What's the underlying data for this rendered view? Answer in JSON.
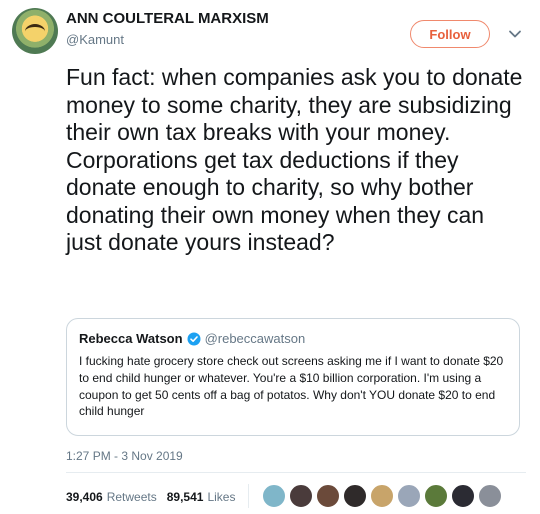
{
  "author": {
    "name": "ANN COULTERAL MARXISM",
    "handle": "@Kamunt"
  },
  "follow_label": "Follow",
  "tweet_text": "Fun fact: when companies ask you to donate money to some charity, they are subsidizing their own tax breaks with your money. Corporations get tax deductions if they donate enough to charity, so why bother donating their own money when they can just donate yours instead?",
  "quoted": {
    "name": "Rebecca Watson",
    "handle": "@rebeccawatson",
    "text": "I fucking hate grocery store check out screens asking me if I want to donate $20 to end child hunger or whatever. You're a $10 billion corporation. I'm using a coupon to get 50 cents off a bag of potatos. Why don't YOU donate $20 to end child hunger"
  },
  "timestamp": "1:27 PM - 3 Nov 2019",
  "stats": {
    "retweets_count": "39,406",
    "retweets_label": "Retweets",
    "likes_count": "89,541",
    "likes_label": "Likes"
  },
  "colors": {
    "follow_accent": "#e8603c",
    "verified_blue": "#1da1f2",
    "muted_text": "#657786"
  },
  "icons": {
    "verified": "verified-badge-icon",
    "chevron": "chevron-down-icon"
  },
  "liker_avatars": [
    "#7fb6c9",
    "#4a3b3b",
    "#6b4a3a",
    "#2f2a2a",
    "#c8a46a",
    "#9aa6b8",
    "#5b7a3a",
    "#2b2b33",
    "#8a8f99"
  ]
}
